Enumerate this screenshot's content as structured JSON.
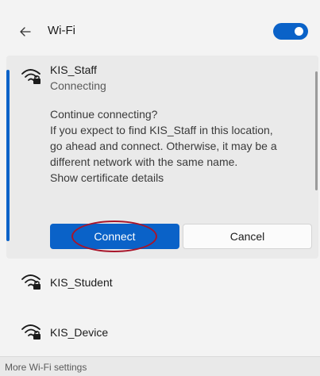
{
  "header": {
    "back_icon": "arrow-left-icon",
    "title": "Wi-Fi",
    "wifi_toggle_on": true,
    "accent_color": "#0a62c8"
  },
  "expanded_network": {
    "icon": "wifi-secured-icon",
    "name": "KIS_Staff",
    "status": "Connecting",
    "prompt_lines": [
      "Continue connecting?",
      "If you expect to find KIS_Staff in this location,",
      "go ahead and connect. Otherwise, it may be a",
      "different network with the same name."
    ],
    "certificate_link": "Show certificate details",
    "connect_label": "Connect",
    "cancel_label": "Cancel"
  },
  "networks": [
    {
      "name": "KIS_Student",
      "icon": "wifi-secured-icon"
    },
    {
      "name": "KIS_Device",
      "icon": "wifi-secured-icon"
    }
  ],
  "footer": {
    "link": "More Wi-Fi settings"
  }
}
